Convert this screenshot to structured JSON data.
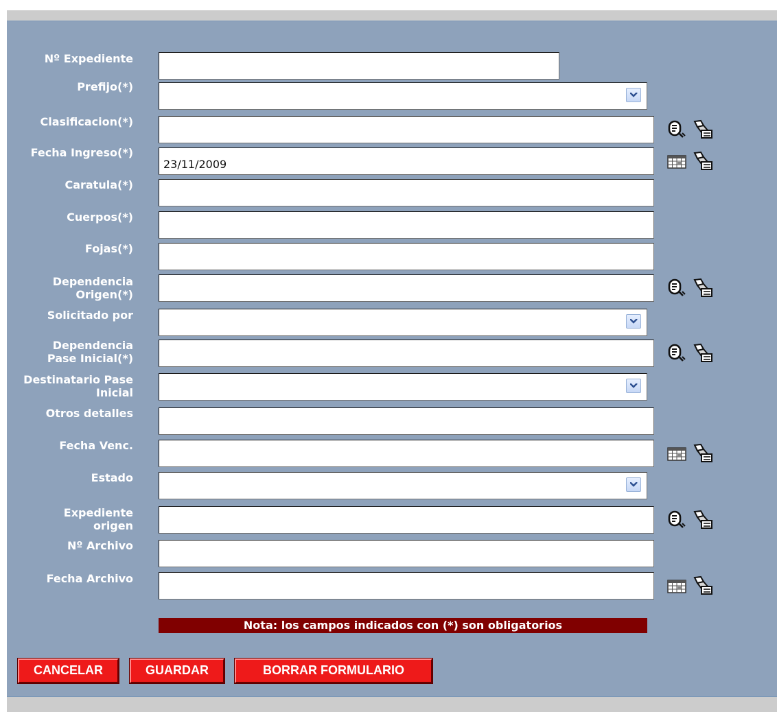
{
  "form": {
    "fields": {
      "nro_expediente": {
        "label": "Nº Expediente",
        "value": ""
      },
      "prefijo": {
        "label": "Prefijo(*)",
        "value": ""
      },
      "clasificacion": {
        "label": "Clasificacion(*)",
        "value": ""
      },
      "fecha_ingreso": {
        "label": "Fecha Ingreso(*)",
        "value": "23/11/2009"
      },
      "caratula": {
        "label": "Caratula(*)",
        "value": ""
      },
      "cuerpos": {
        "label": "Cuerpos(*)",
        "value": ""
      },
      "fojas": {
        "label": "Fojas(*)",
        "value": ""
      },
      "dependencia_origen": {
        "label_line1": "Dependencia",
        "label_line2": "Origen(*)",
        "value": ""
      },
      "solicitado_por": {
        "label": "Solicitado por",
        "value": ""
      },
      "dependencia_pase_inicial": {
        "label_line1": "Dependencia",
        "label_line2": "Pase Inicial(*)",
        "value": ""
      },
      "destinatario_pase_inicial": {
        "label_line1": "Destinatario Pase",
        "label_line2": "Inicial",
        "value": ""
      },
      "otros_detalles": {
        "label": "Otros detalles",
        "value": ""
      },
      "fecha_venc": {
        "label": "Fecha Venc.",
        "value": ""
      },
      "estado": {
        "label": "Estado",
        "value": ""
      },
      "expediente_origen": {
        "label_line1": "Expediente",
        "label_line2": "origen",
        "value": ""
      },
      "nro_archivo": {
        "label": "Nº Archivo",
        "value": ""
      },
      "fecha_archivo": {
        "label": "Fecha Archivo",
        "value": ""
      }
    },
    "note": "Nota: los campos indicados con (*) son obligatorios"
  },
  "buttons": {
    "cancel": "CANCELAR",
    "save": "GUARDAR",
    "reset": "BORRAR FORMULARIO"
  },
  "icons": {
    "search": "search-lookup-icon",
    "clear": "eraser-clear-icon",
    "calendar": "calendar-icon"
  },
  "colors": {
    "panel": "#8ea2bb",
    "note_bg": "#800000",
    "button_bg": "#ee1a1a",
    "label_text": "#ffffff"
  }
}
